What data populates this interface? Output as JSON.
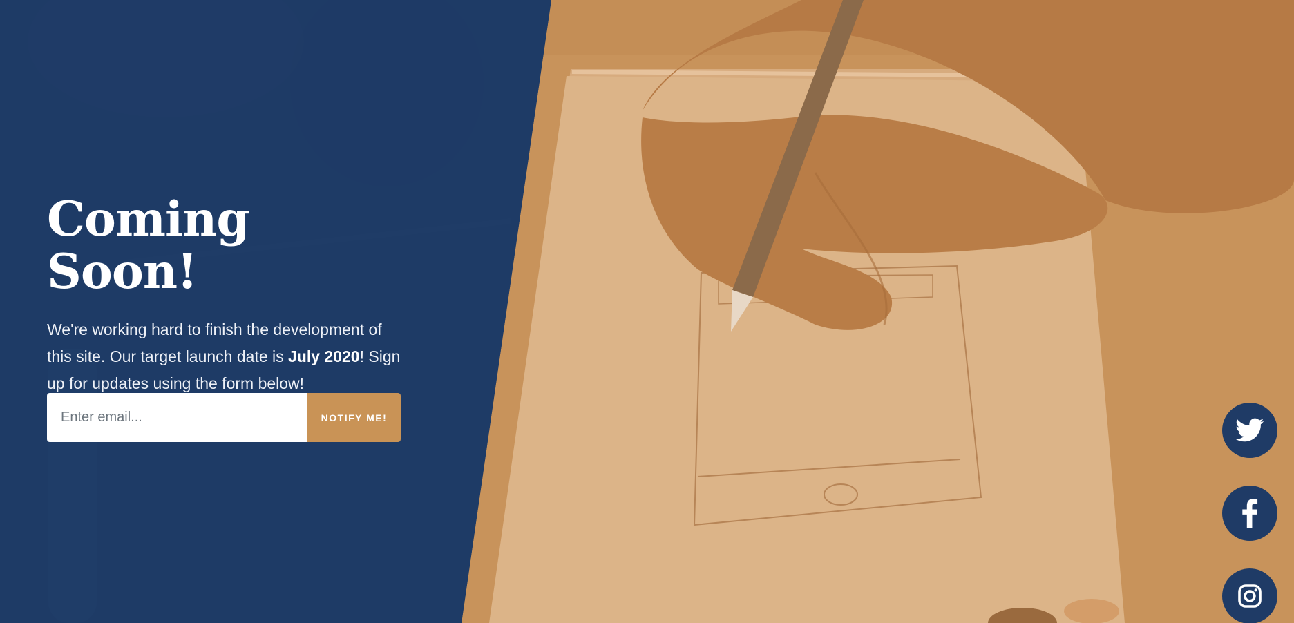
{
  "hero": {
    "title": "Coming Soon!",
    "lead_part1": "We're working hard to finish the development of this site. Our target launch date is ",
    "lead_date": "July 2020",
    "lead_part2": "! Sign up for updates using the form below!"
  },
  "signup": {
    "email_placeholder": "Enter email...",
    "email_value": "",
    "button_label": "NOTIFY ME!"
  },
  "social": {
    "items": [
      {
        "name": "twitter",
        "icon": "twitter-icon"
      },
      {
        "name": "facebook",
        "icon": "facebook-icon"
      },
      {
        "name": "instagram",
        "icon": "instagram-icon"
      }
    ]
  },
  "colors": {
    "panel_blue": "#1f3b66",
    "accent_orange": "#c99356",
    "photo_tone": "#c9945c"
  }
}
